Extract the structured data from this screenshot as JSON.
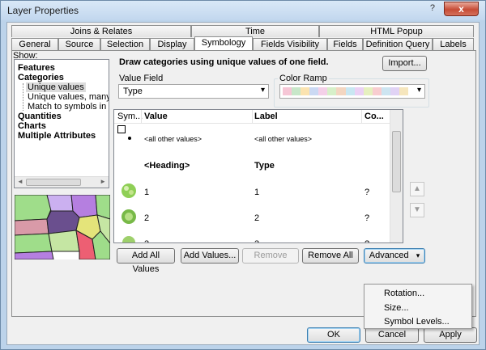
{
  "window": {
    "title": "Layer Properties",
    "close_glyph": "x"
  },
  "tabs_back": [
    "Joins & Relates",
    "Time",
    "HTML Popup"
  ],
  "tabs_front": [
    "General",
    "Source",
    "Selection",
    "Display",
    "Symbology",
    "Fields Visibility",
    "Fields",
    "Definition Query",
    "Labels"
  ],
  "show": {
    "label": "Show:",
    "tree": [
      "Features",
      "Categories",
      "Unique values",
      "Unique values, many fiel",
      "Match to symbols in a sty",
      "Quantities",
      "Charts",
      "Multiple Attributes"
    ]
  },
  "symbology": {
    "heading": "Draw categories using unique values of one field.",
    "import_button": "Import...",
    "value_field_label": "Value Field",
    "value_field_value": "Type",
    "color_ramp_label": "Color Ramp",
    "ramp_colors": [
      "#f6c6d6",
      "#c8e7c9",
      "#fbe3b0",
      "#cbd9f3",
      "#f4d0e8",
      "#d7f0c9",
      "#f3d6c1",
      "#c9e7f2",
      "#ebd1f4",
      "#e6f0bf",
      "#f8cdd0",
      "#cde5f1",
      "#e1d3f5",
      "#f6e6bd"
    ]
  },
  "grid": {
    "columns": [
      "Sym...",
      "Value",
      "Label",
      "Co..."
    ],
    "rows": [
      {
        "value": "<all other values>",
        "label": "<all other values>",
        "count": ""
      },
      {
        "value": "<Heading>",
        "label": "Type",
        "count": ""
      },
      {
        "value": "1",
        "label": "1",
        "count": "?"
      },
      {
        "value": "2",
        "label": "2",
        "count": "?"
      },
      {
        "value": "3",
        "label": "3",
        "count": "?"
      }
    ]
  },
  "buttons": {
    "add_all": "Add All Values",
    "add_values": "Add Values...",
    "remove": "Remove",
    "remove_all": "Remove All",
    "advanced": "Advanced",
    "ok": "OK",
    "cancel": "Cancel",
    "apply": "Apply"
  },
  "advanced_menu": [
    "Rotation...",
    "Size...",
    "Symbol Levels..."
  ],
  "arrows": {
    "up": "▲",
    "down": "▼",
    "left": "◄",
    "right": "►",
    "dropdown": "▾"
  }
}
